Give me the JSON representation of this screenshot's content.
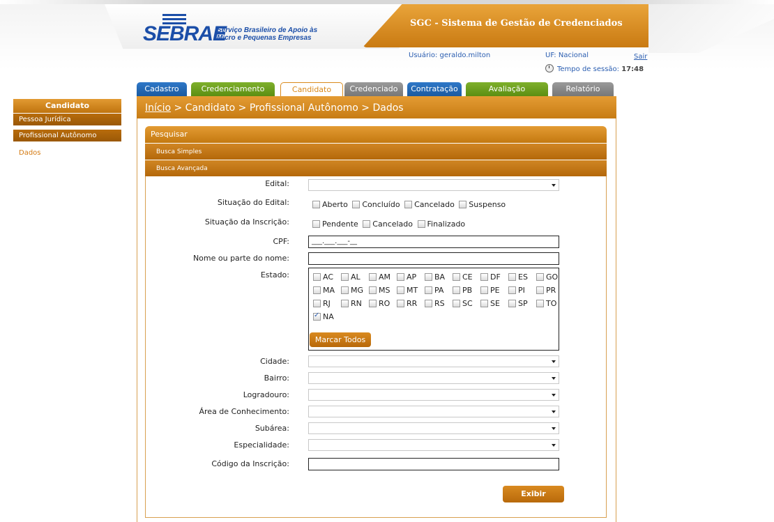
{
  "header": {
    "brand": "SEBRAE",
    "brand_subtitle_1": "Serviço Brasileiro de Apoio às",
    "brand_subtitle_2": "Micro e Pequenas Empresas",
    "system_title": "SGC - Sistema de Gestão de Credenciados",
    "user_label": "Usuário: geraldo.milton",
    "uf_label": "UF: Nacional",
    "logout": "Sair",
    "session_label": "Tempo de sessão:",
    "session_time": "17:48"
  },
  "tabs": [
    {
      "label": "Cadastro"
    },
    {
      "label": "Credenciamento"
    },
    {
      "label": "Candidato"
    },
    {
      "label": "Credenciado"
    },
    {
      "label": "Contratação"
    },
    {
      "label": "Avaliação"
    },
    {
      "label": "Relatório"
    }
  ],
  "sidebar": {
    "title": "Candidato",
    "items": [
      {
        "label": "Pessoa Jurídica"
      },
      {
        "label": "Profissional Autônomo"
      },
      {
        "label": "Dados"
      }
    ]
  },
  "breadcrumb": {
    "home": "Início",
    "rest": " > Candidato > Profissional Autônomo > Dados"
  },
  "search": {
    "title": "Pesquisar",
    "simple": "Busca Simples",
    "advanced": "Busca Avançada"
  },
  "form": {
    "edital_label": "Edital:",
    "situacao_edital_label": "Situação do Edital:",
    "situacao_edital_options": [
      "Aberto",
      "Concluído",
      "Cancelado",
      "Suspenso"
    ],
    "situacao_inscricao_label": "Situação da Inscrição:",
    "situacao_inscricao_options": [
      "Pendente",
      "Cancelado",
      "Finalizado"
    ],
    "cpf_label": "CPF:",
    "cpf_mask": "___.___.___-__",
    "nome_label": "Nome ou parte do nome:",
    "estado_label": "Estado:",
    "estados": [
      "AC",
      "AL",
      "AM",
      "AP",
      "BA",
      "CE",
      "DF",
      "ES",
      "GO",
      "MA",
      "MG",
      "MS",
      "MT",
      "PA",
      "PB",
      "PE",
      "PI",
      "PR",
      "RJ",
      "RN",
      "RO",
      "RR",
      "RS",
      "SC",
      "SE",
      "SP",
      "TO",
      "NA"
    ],
    "estado_checked": "NA",
    "marcar_todos": "Marcar Todos",
    "cidade_label": "Cidade:",
    "bairro_label": "Bairro:",
    "logradouro_label": "Logradouro:",
    "area_label": "Área de Conhecimento:",
    "subarea_label": "Subárea:",
    "especialidade_label": "Especialidade:",
    "codigo_label": "Código da Inscrição:",
    "submit": "Exibir"
  }
}
